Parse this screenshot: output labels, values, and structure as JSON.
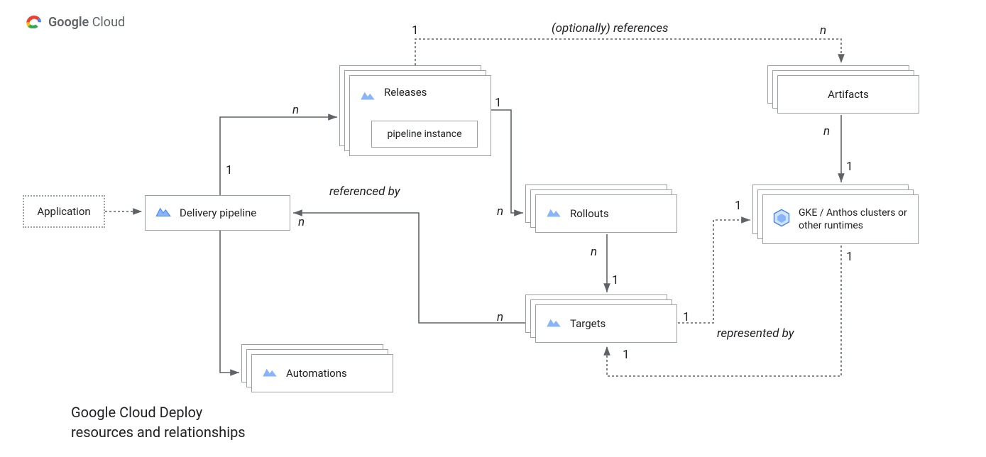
{
  "brand": {
    "name": "Google Cloud"
  },
  "caption": "Google Cloud Deploy\nresources and relationships",
  "labels": {
    "optionally_references": "(optionally) references",
    "referenced_by": "referenced by",
    "represented_by": "represented by"
  },
  "nodes": {
    "application": "Application",
    "delivery_pipeline": "Delivery pipeline",
    "releases": "Releases",
    "pipeline_instance": "pipeline instance",
    "rollouts": "Rollouts",
    "targets": "Targets",
    "automations": "Automations",
    "artifacts": "Artifacts",
    "runtimes": "GKE / Anthos clusters or other runtimes"
  },
  "cardinality": {
    "app_to_pipeline_target": "1",
    "pipeline_to_releases_source": "n",
    "releases_top_one": "1",
    "releases_right_one": "1",
    "referenced_by_n": "n",
    "rollouts_left_n": "n",
    "rollouts_down_n": "n",
    "rollouts_to_targets_one": "1",
    "targets_left_n": "n",
    "targets_right_one": "1",
    "targets_bottom_one": "1",
    "artifacts_top_n": "n",
    "artifacts_bottom_n": "n",
    "runtimes_top_one": "1",
    "runtimes_left_one": "1",
    "runtimes_bottom_one": "1"
  }
}
